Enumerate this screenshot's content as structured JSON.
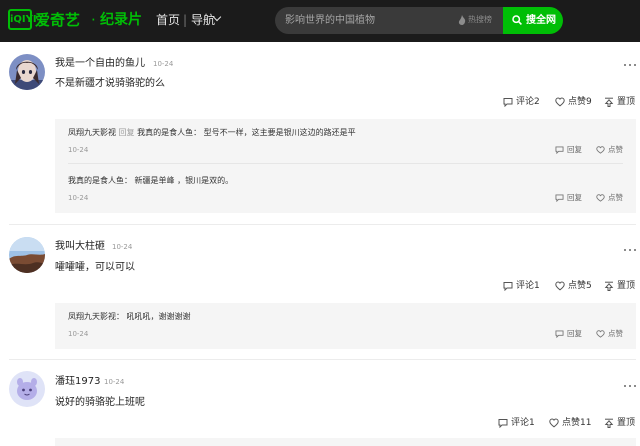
{
  "header": {
    "logo_text": "iQIYI",
    "brand": "爱奇艺",
    "separator_dot": "·",
    "channel": "纪录片",
    "nav_home": "首页",
    "nav_sep": "|",
    "nav_menu": "导航",
    "search_placeholder": "影响世界的中国植物",
    "hot_label": "热搜榜",
    "search_button": "搜全网",
    "accent_color": "#00be06"
  },
  "comments": [
    {
      "user": "我是一个自由的鱼儿",
      "time": "10-24",
      "text": "不是新疆才说骑骆驼的么",
      "comment_label": "评论2",
      "like_label": "点赞9",
      "top_label": "置顶",
      "replies": [
        {
          "from": "凤翔九天影视",
          "verb": "回复",
          "to": "我真的是食人鱼：",
          "text": "型号不一样，这主要是银川这边的路还是平",
          "time": "10-24",
          "reply_label": "回复",
          "like_label": "点赞"
        },
        {
          "from": "我真的是食人鱼：",
          "verb": "",
          "to": "",
          "text": "新疆是单峰 ，银川是双的。",
          "time": "10-24",
          "reply_label": "回复",
          "like_label": "点赞"
        }
      ]
    },
    {
      "user": "我叫大柱砸",
      "time": "10-24",
      "text": "嚯嚯嚯，可以可以",
      "comment_label": "评论1",
      "like_label": "点赞5",
      "top_label": "置顶",
      "replies": [
        {
          "from": "凤翔九天影视：",
          "verb": "",
          "to": "",
          "text": "吼吼吼，谢谢谢谢",
          "time": "10-24",
          "reply_label": "回复",
          "like_label": "点赞"
        }
      ]
    },
    {
      "user": "潘珏1973",
      "time": "10-24",
      "text": "说好的骑骆驼上班呢",
      "comment_label": "评论1",
      "like_label": "点赞11",
      "top_label": "置顶",
      "replies": []
    }
  ]
}
